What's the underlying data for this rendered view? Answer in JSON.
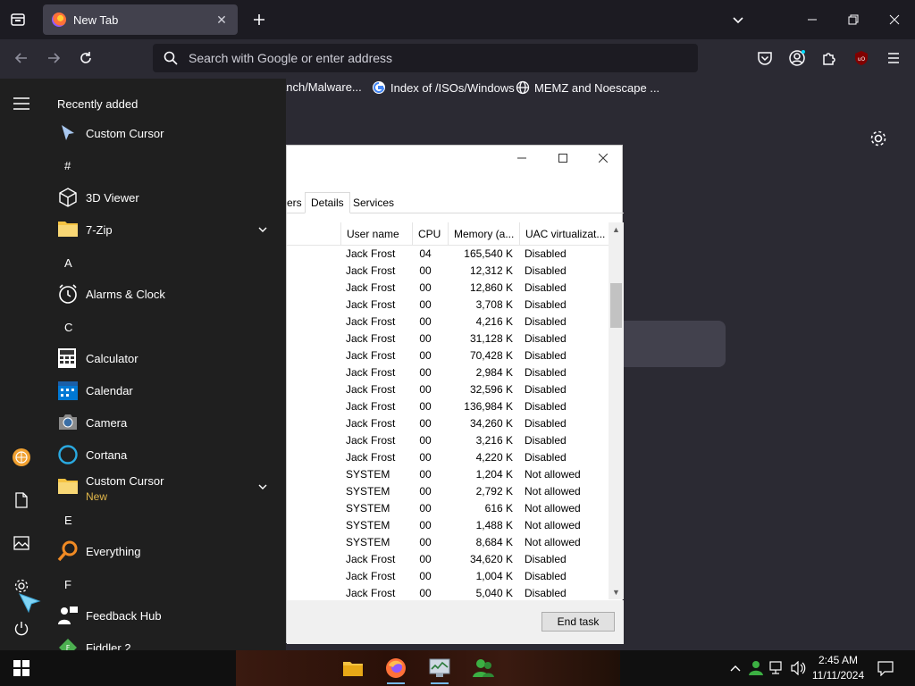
{
  "browser": {
    "tab_title": "New Tab",
    "url_placeholder": "Search with Google or enter address",
    "bookmarks": [
      {
        "label": "anch/Malware..."
      },
      {
        "label": "Index of /ISOs/Windows"
      },
      {
        "label": "MEMZ and Noescape ..."
      }
    ]
  },
  "task_manager": {
    "tabs": [
      {
        "label": "ers"
      },
      {
        "label": "Details"
      },
      {
        "label": "Services"
      }
    ],
    "active_tab": "Details",
    "columns": {
      "user": "User name",
      "cpu": "CPU",
      "memory": "Memory (a...",
      "uac": "UAC virtualizat..."
    },
    "rows": [
      {
        "user": "Jack Frost",
        "cpu": "04",
        "mem": "165,540 K",
        "uac": "Disabled"
      },
      {
        "user": "Jack Frost",
        "cpu": "00",
        "mem": "12,312 K",
        "uac": "Disabled"
      },
      {
        "user": "Jack Frost",
        "cpu": "00",
        "mem": "12,860 K",
        "uac": "Disabled"
      },
      {
        "user": "Jack Frost",
        "cpu": "00",
        "mem": "3,708 K",
        "uac": "Disabled"
      },
      {
        "user": "Jack Frost",
        "cpu": "00",
        "mem": "4,216 K",
        "uac": "Disabled"
      },
      {
        "user": "Jack Frost",
        "cpu": "00",
        "mem": "31,128 K",
        "uac": "Disabled"
      },
      {
        "user": "Jack Frost",
        "cpu": "00",
        "mem": "70,428 K",
        "uac": "Disabled"
      },
      {
        "user": "Jack Frost",
        "cpu": "00",
        "mem": "2,984 K",
        "uac": "Disabled"
      },
      {
        "user": "Jack Frost",
        "cpu": "00",
        "mem": "32,596 K",
        "uac": "Disabled"
      },
      {
        "user": "Jack Frost",
        "cpu": "00",
        "mem": "136,984 K",
        "uac": "Disabled"
      },
      {
        "user": "Jack Frost",
        "cpu": "00",
        "mem": "34,260 K",
        "uac": "Disabled"
      },
      {
        "user": "Jack Frost",
        "cpu": "00",
        "mem": "3,216 K",
        "uac": "Disabled"
      },
      {
        "user": "Jack Frost",
        "cpu": "00",
        "mem": "4,220 K",
        "uac": "Disabled"
      },
      {
        "user": "SYSTEM",
        "cpu": "00",
        "mem": "1,204 K",
        "uac": "Not allowed"
      },
      {
        "user": "SYSTEM",
        "cpu": "00",
        "mem": "2,792 K",
        "uac": "Not allowed"
      },
      {
        "user": "SYSTEM",
        "cpu": "00",
        "mem": "616 K",
        "uac": "Not allowed"
      },
      {
        "user": "SYSTEM",
        "cpu": "00",
        "mem": "1,488 K",
        "uac": "Not allowed"
      },
      {
        "user": "SYSTEM",
        "cpu": "00",
        "mem": "8,684 K",
        "uac": "Not allowed"
      },
      {
        "user": "Jack Frost",
        "cpu": "00",
        "mem": "34,620 K",
        "uac": "Disabled"
      },
      {
        "user": "Jack Frost",
        "cpu": "00",
        "mem": "1,004 K",
        "uac": "Disabled"
      },
      {
        "user": "Jack Frost",
        "cpu": "00",
        "mem": "5,040 K",
        "uac": "Disabled"
      }
    ],
    "end_task_label": "End task"
  },
  "start_menu": {
    "heading": "Recently added",
    "entries": [
      {
        "kind": "app",
        "name": "Custom Cursor",
        "icon": "cursor-arrow-icon"
      },
      {
        "kind": "letter",
        "name": "#"
      },
      {
        "kind": "app",
        "name": "3D Viewer",
        "icon": "cube-icon"
      },
      {
        "kind": "app",
        "name": "7-Zip",
        "icon": "folder-icon",
        "expand": true
      },
      {
        "kind": "letter",
        "name": "A"
      },
      {
        "kind": "app",
        "name": "Alarms & Clock",
        "icon": "alarm-clock-icon"
      },
      {
        "kind": "letter",
        "name": "C"
      },
      {
        "kind": "app",
        "name": "Calculator",
        "icon": "calculator-icon"
      },
      {
        "kind": "app",
        "name": "Calendar",
        "icon": "calendar-icon"
      },
      {
        "kind": "app",
        "name": "Camera",
        "icon": "camera-icon"
      },
      {
        "kind": "app",
        "name": "Cortana",
        "icon": "cortana-ring-icon"
      },
      {
        "kind": "app",
        "name": "Custom Cursor",
        "icon": "folder-icon",
        "expand": true,
        "sub": "New"
      },
      {
        "kind": "letter",
        "name": "E"
      },
      {
        "kind": "app",
        "name": "Everything",
        "icon": "magnifier-orange-icon"
      },
      {
        "kind": "letter",
        "name": "F"
      },
      {
        "kind": "app",
        "name": "Feedback Hub",
        "icon": "feedback-people-icon"
      },
      {
        "kind": "app",
        "name": "Fiddler 2",
        "icon": "fiddler-icon"
      }
    ]
  },
  "taskbar": {
    "time": "2:45 AM",
    "date": "11/11/2024"
  },
  "colors": {
    "accent": "#76b9ed",
    "new_badge": "#e0b64a",
    "start_bg": "#1f1f1f",
    "browser_bg": "#2b2a33"
  }
}
